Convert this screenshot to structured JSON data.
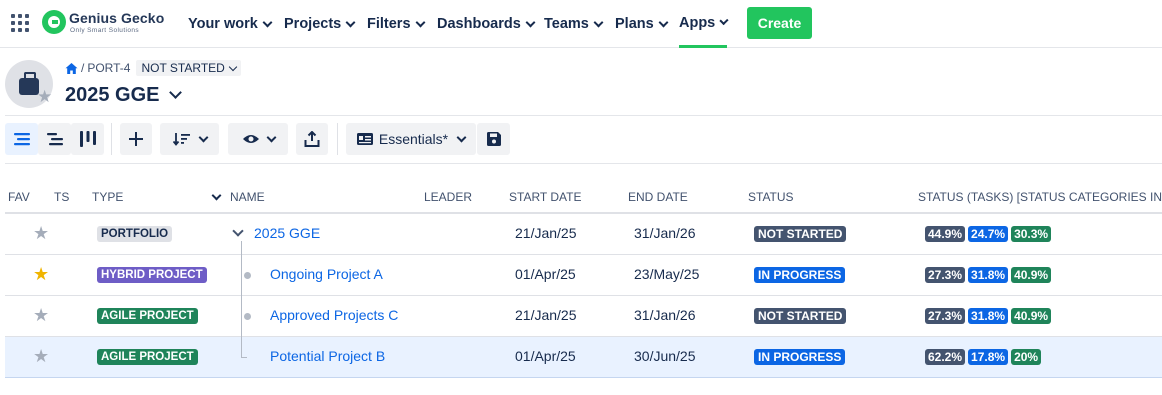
{
  "nav": {
    "logo_title": "Genius Gecko",
    "logo_subtitle": "Only Smart Solutions",
    "items": [
      {
        "label": "Your work"
      },
      {
        "label": "Projects"
      },
      {
        "label": "Filters"
      },
      {
        "label": "Dashboards"
      },
      {
        "label": "Teams"
      },
      {
        "label": "Plans"
      },
      {
        "label": "Apps"
      }
    ],
    "active_item": "Apps",
    "create_label": "Create",
    "accent_color": "#22c55e"
  },
  "header": {
    "breadcrumb_key": "PORT-4",
    "breadcrumb_separator": "/",
    "status_dropdown": "NOT STARTED",
    "title": "2025 GGE",
    "avatar_icon": "briefcase-icon"
  },
  "toolbar": {
    "view_icons": [
      "hierarchy-list-icon",
      "indented-list-icon",
      "board-icon"
    ],
    "essentials_label": "Essentials*",
    "action_icons": [
      "plus-icon",
      "sort-icon",
      "eye-icon",
      "export-icon",
      "id-card-icon",
      "save-icon"
    ]
  },
  "table": {
    "columns": {
      "fav": "FAV",
      "ts": "TS",
      "type": "TYPE",
      "name": "NAME",
      "leader": "LEADER",
      "start": "START DATE",
      "end": "END DATE",
      "status": "STATUS",
      "status_tasks": "STATUS (TASKS) [STATUS CATEGORIES IN %]"
    },
    "rows": [
      {
        "favorite": false,
        "type": "PORTFOLIO",
        "name": "2025 GGE",
        "start": "21/Jan/25",
        "end": "31/Jan/26",
        "status": "NOT STARTED",
        "pct": [
          "44.9%",
          "24.7%",
          "30.3%"
        ]
      },
      {
        "favorite": true,
        "type": "HYBRID PROJECT",
        "name": "Ongoing Project A",
        "start": "01/Apr/25",
        "end": "23/May/25",
        "status": "IN PROGRESS",
        "pct": [
          "27.3%",
          "31.8%",
          "40.9%"
        ]
      },
      {
        "favorite": false,
        "type": "AGILE PROJECT",
        "name": "Approved Projects C",
        "start": "21/Jan/25",
        "end": "31/Jan/26",
        "status": "NOT STARTED",
        "pct": [
          "27.3%",
          "31.8%",
          "40.9%"
        ]
      },
      {
        "favorite": false,
        "type": "AGILE PROJECT",
        "name": "Potential Project B",
        "start": "01/Apr/25",
        "end": "30/Jun/25",
        "status": "IN PROGRESS",
        "pct": [
          "62.2%",
          "17.8%",
          "20%"
        ]
      }
    ],
    "colors": {
      "portfolio_bg": "#dfe1e6",
      "hybrid_bg": "#6e5dc6",
      "agile_bg": "#1f845a",
      "not_started_bg": "#44546f",
      "in_progress_bg": "#0c66e4",
      "pct_todo": "#44546f",
      "pct_inprogress": "#0c66e4",
      "pct_done": "#1f845a"
    }
  }
}
